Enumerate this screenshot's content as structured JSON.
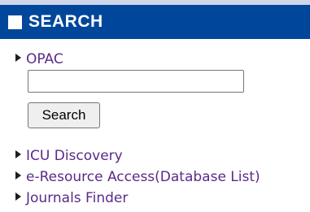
{
  "section": {
    "title": "SEARCH"
  },
  "opac": {
    "label": "OPAC",
    "input_value": "",
    "button_label": "Search"
  },
  "links": [
    {
      "label": "ICU Discovery"
    },
    {
      "label": "e-Resource Access(Database List)"
    },
    {
      "label": "Journals Finder"
    }
  ],
  "colors": {
    "header_bg": "#00479b",
    "link": "#5a2a8a"
  },
  "icons": {
    "header": "square-icon",
    "bullet": "triangle-right-icon"
  }
}
